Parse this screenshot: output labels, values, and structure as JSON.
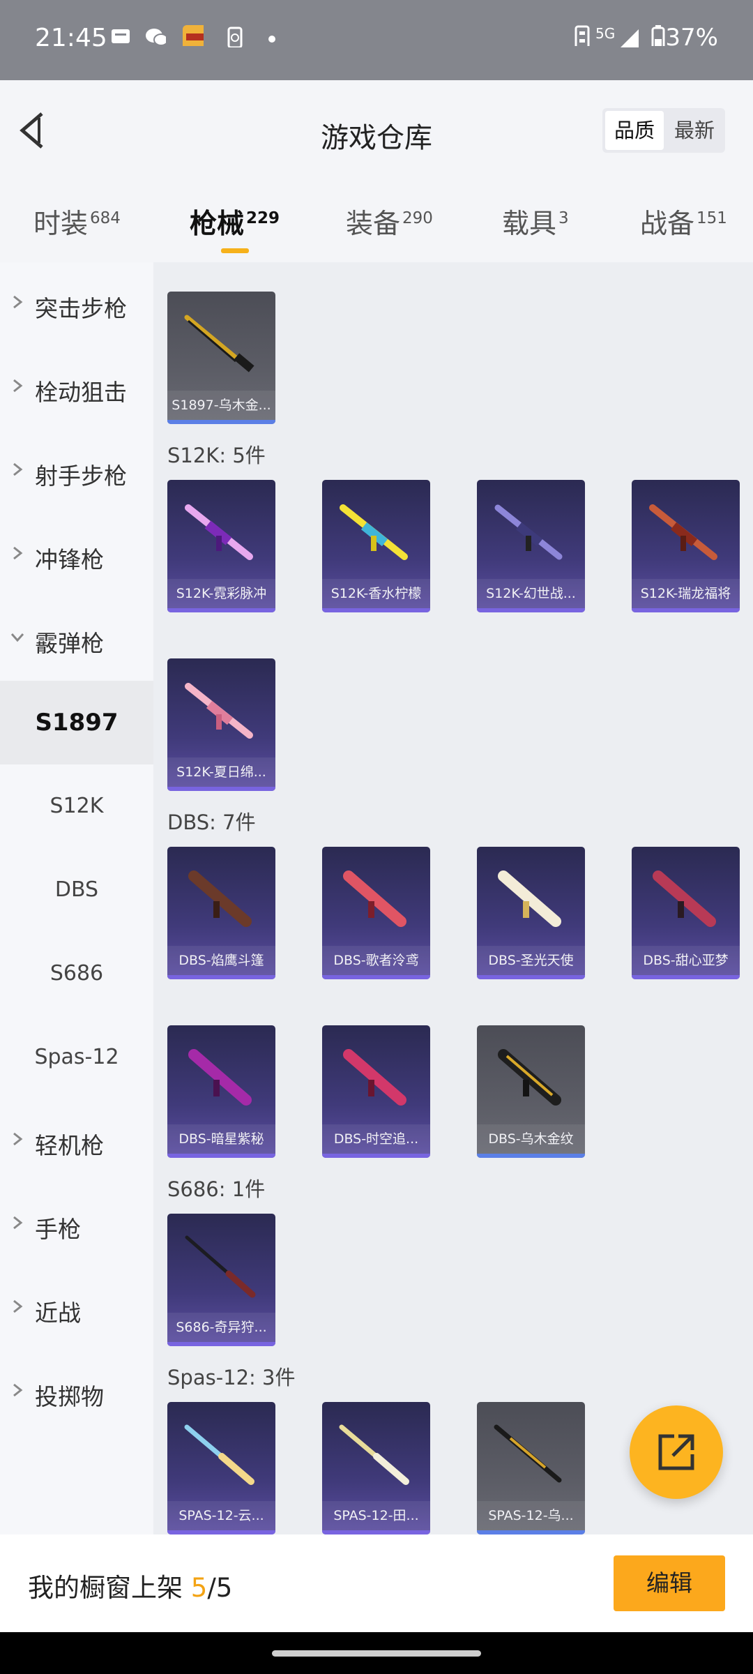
{
  "status": {
    "time": "21:45",
    "network": "5G",
    "battery": "37%"
  },
  "header": {
    "title": "游戏仓库",
    "sort": {
      "quality": "品质",
      "newest": "最新"
    }
  },
  "tabs": [
    {
      "label": "时装",
      "count": "684"
    },
    {
      "label": "枪械",
      "count": "229"
    },
    {
      "label": "装备",
      "count": "290"
    },
    {
      "label": "载具",
      "count": "3"
    },
    {
      "label": "战备",
      "count": "151"
    }
  ],
  "sidebar": {
    "categories": [
      "突击步枪",
      "栓动狙击",
      "射手步枪",
      "冲锋枪",
      "霰弹枪",
      "轻机枪",
      "手枪",
      "近战",
      "投掷物"
    ],
    "subs": [
      "S1897",
      "S12K",
      "DBS",
      "S686",
      "Spas-12"
    ]
  },
  "groups": {
    "s1897": {
      "items": [
        "S1897-乌木金..."
      ]
    },
    "s12k": {
      "title": "S12K: 5件",
      "items": [
        "S12K-霓彩脉冲",
        "S12K-香水柠檬",
        "S12K-幻世战...",
        "S12K-瑞龙福将",
        "S12K-夏日绵..."
      ]
    },
    "dbs": {
      "title": "DBS: 7件",
      "items": [
        "DBS-焰鹰斗篷",
        "DBS-歌者泠鸢",
        "DBS-圣光天使",
        "DBS-甜心亚梦",
        "DBS-暗星紫秘",
        "DBS-时空追...",
        "DBS-乌木金纹"
      ]
    },
    "s686": {
      "title": "S686: 1件",
      "items": [
        "S686-奇异狩..."
      ]
    },
    "spas": {
      "title": "Spas-12: 3件",
      "items": [
        "SPAS-12-云...",
        "SPAS-12-田...",
        "SPAS-12-乌..."
      ]
    }
  },
  "footer": {
    "label": "我的橱窗上架",
    "current": "5",
    "total": "/5",
    "edit": "编辑"
  }
}
